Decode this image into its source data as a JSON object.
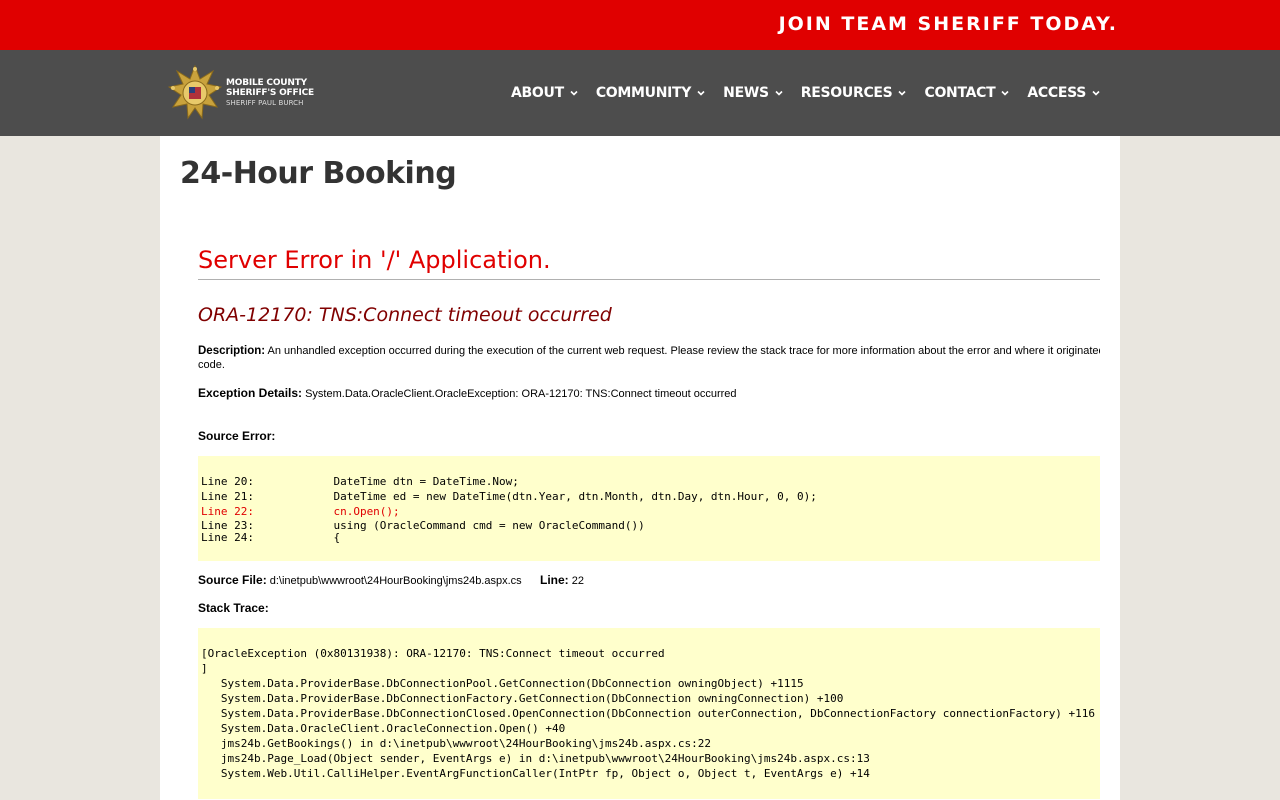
{
  "topbar": {
    "join_text": "JOIN TEAM SHERIFF TODAY."
  },
  "logo": {
    "line1": "MOBILE COUNTY",
    "line2": "SHERIFF'S OFFICE",
    "line3": "SHERIFF PAUL BURCH"
  },
  "menu": [
    {
      "label": "ABOUT"
    },
    {
      "label": "COMMUNITY"
    },
    {
      "label": "NEWS"
    },
    {
      "label": "RESOURCES"
    },
    {
      "label": "CONTACT"
    },
    {
      "label": "ACCESS"
    }
  ],
  "page": {
    "title": "24-Hour Booking"
  },
  "error": {
    "heading": "Server Error in '/' Application.",
    "message": "ORA-12170: TNS:Connect timeout occurred",
    "description_label": "Description:",
    "description_text": "An unhandled exception occurred during the execution of the current web request. Please review the stack trace for more information about the error and where it originated in the",
    "description_tail": "code.",
    "exception_label": "Exception Details:",
    "exception_text": "System.Data.OracleClient.OracleException: ORA-12170: TNS:Connect timeout occurred",
    "source_error_label": "Source Error:",
    "source_lines": [
      {
        "text": "Line 20:            DateTime dtn = DateTime.Now;",
        "highlight": false
      },
      {
        "text": "Line 21:            DateTime ed = new DateTime(dtn.Year, dtn.Month, dtn.Day, dtn.Hour, 0, 0);",
        "highlight": false
      },
      {
        "text": "Line 22:            cn.Open();",
        "highlight": true
      },
      {
        "text": "Line 23:            using (OracleCommand cmd = new OracleCommand())",
        "highlight": false
      },
      {
        "text": "Line 24:            {",
        "highlight": false
      }
    ],
    "source_file_label": "Source File:",
    "source_file_value": "d:\\inetpub\\wwwroot\\24HourBooking\\jms24b.aspx.cs",
    "line_label": "Line:",
    "line_value": "22",
    "stack_trace_label": "Stack Trace:",
    "stack_lines": [
      "[OracleException (0x80131938): ORA-12170: TNS:Connect timeout occurred",
      "]",
      "   System.Data.ProviderBase.DbConnectionPool.GetConnection(DbConnection owningObject) +1115",
      "   System.Data.ProviderBase.DbConnectionFactory.GetConnection(DbConnection owningConnection) +100",
      "   System.Data.ProviderBase.DbConnectionClosed.OpenConnection(DbConnection outerConnection, DbConnectionFactory connectionFactory) +116",
      "   System.Data.OracleClient.OracleConnection.Open() +40",
      "   jms24b.GetBookings() in d:\\inetpub\\wwwroot\\24HourBooking\\jms24b.aspx.cs:22",
      "   jms24b.Page_Load(Object sender, EventArgs e) in d:\\inetpub\\wwwroot\\24HourBooking\\jms24b.aspx.cs:13",
      "   System.Web.Util.CalliHelper.EventArgFunctionCaller(IntPtr fp, Object o, Object t, EventArgs e) +14"
    ]
  }
}
